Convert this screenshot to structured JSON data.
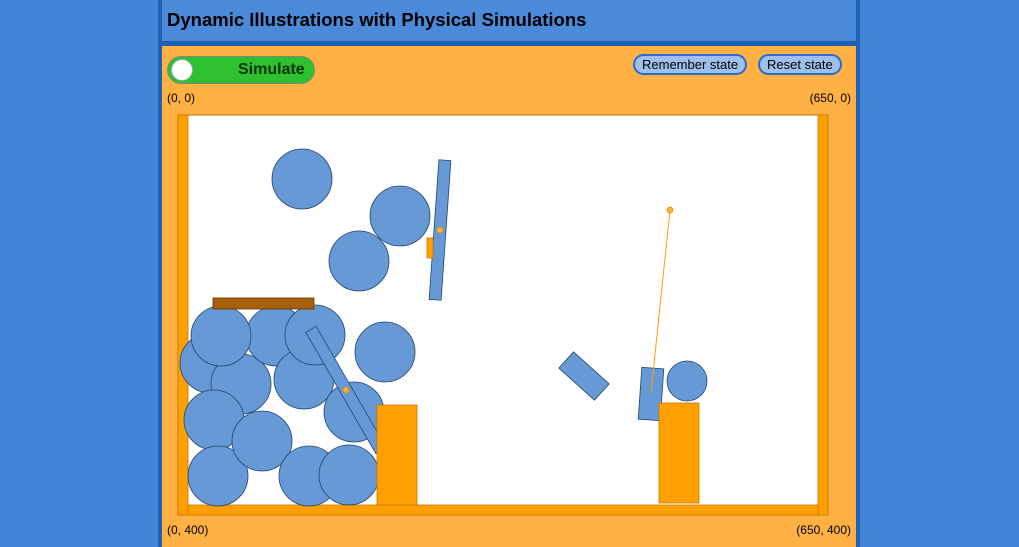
{
  "app": {
    "title": "Dynamic Illustrations with Physical Simulations"
  },
  "toolbar": {
    "simulate_label": "Simulate",
    "simulate_on": true,
    "remember_label": "Remember state",
    "reset_label": "Reset state"
  },
  "coords": {
    "top_left": "(0, 0)",
    "top_right": "(650, 0)",
    "bottom_left": "(0, 400)",
    "bottom_right": "(650, 400)"
  },
  "colors": {
    "background": "#4285d6",
    "header": "#4a8ad9",
    "panel": "#ffb243",
    "body_fill": "#6699d6",
    "static_fill": "#ff9f00",
    "plank_fill": "#a8600a",
    "toggle_on": "#2ec02e"
  }
}
